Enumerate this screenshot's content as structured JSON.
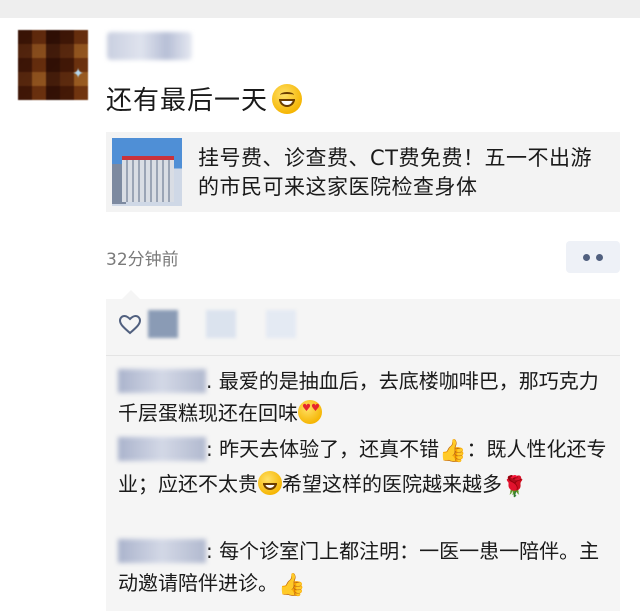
{
  "post": {
    "text": "还有最后一天",
    "emoji": "grinning-face",
    "link_card": {
      "title": "挂号费、诊查费、CT费免费！五一不出游的市民可来这家医院检查身体"
    },
    "time": "32分钟前"
  },
  "comments": [
    {
      "sep": ".",
      "text": "最爱的是抽血后，去底楼咖啡巴，那巧克力千层蛋糕现还在回味",
      "emoji": "smiling-face-with-heart-eyes"
    },
    {
      "sep": ":",
      "text_a": "昨天去体验了，还真不错",
      "text_b": "：既人性化还专业；应还不太贵",
      "text_c": "希望这样的医院越来越多"
    },
    {
      "sep": ":",
      "text": "每个诊室门上都注明：一医一患一陪伴。主动邀请陪伴进诊。"
    }
  ],
  "colors": {
    "link_bg": "#f3f3f3",
    "comments_bg": "#f5f5f5",
    "more_dots": "#51607f"
  }
}
